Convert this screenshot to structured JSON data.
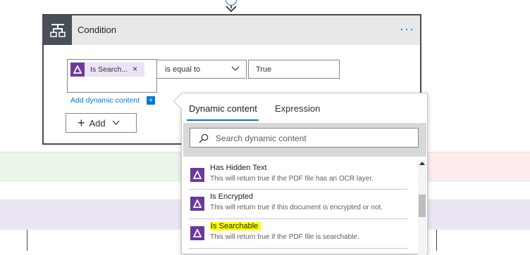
{
  "condition": {
    "title": "Condition",
    "more_label": "···",
    "token_label": "Is Search...",
    "token_close": "×",
    "operator": "is equal to",
    "value": "True",
    "add_dynamic_label": "Add dynamic content",
    "add_dynamic_plus": "+",
    "add_label": "Add",
    "add_plus": "+"
  },
  "panel": {
    "tabs": [
      {
        "label": "Dynamic content",
        "active": true
      },
      {
        "label": "Expression",
        "active": false
      }
    ],
    "search_placeholder": "Search dynamic content",
    "items": [
      {
        "title": "Has Hidden Text",
        "description": "This will return true if the PDF file has an OCR layer."
      },
      {
        "title": "Is Encrypted",
        "description": "This will return true if this document is encrypted or not."
      },
      {
        "title": "Is Searchable",
        "description": "This will return true if the PDF file is searchable.",
        "highlighted": true
      }
    ]
  },
  "colors": {
    "accent": "#0078d4",
    "token_icon": "#6b3a9b",
    "highlight": "#ffff00",
    "card_border": "#4a4a4a"
  },
  "icons": {
    "condition": "condition-split-icon",
    "token": "delta-icon",
    "search": "search-icon"
  }
}
